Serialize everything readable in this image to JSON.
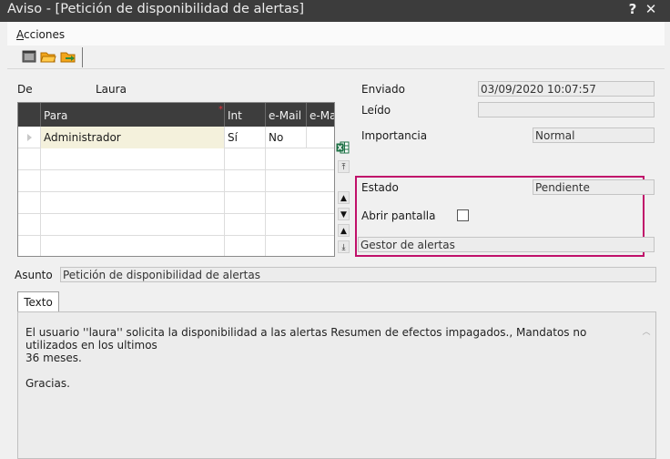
{
  "window": {
    "title": "Aviso - [Petición de disponibilidad de alertas]",
    "help_label": "?",
    "close_label": "✕"
  },
  "menu": {
    "items": [
      {
        "accel": "A",
        "rest": "cciones"
      }
    ]
  },
  "toolbar": {
    "tools": [
      "window-icon",
      "open-folder-icon",
      "folder-arrow-icon"
    ]
  },
  "from": {
    "label": "De",
    "value": "Laura"
  },
  "recipients": {
    "columns": [
      "Para",
      "Int",
      "e-Mail",
      "e-Ma"
    ],
    "rows": [
      {
        "para": "Administrador",
        "int": "Sí",
        "email": "No",
        "email2": ""
      }
    ]
  },
  "sent": {
    "label": "Enviado",
    "value": "03/09/2020 10:07:57"
  },
  "read": {
    "label": "Leído",
    "value": ""
  },
  "importance": {
    "label": "Importancia",
    "value": "Normal"
  },
  "status": {
    "label": "Estado",
    "value": "Pendiente"
  },
  "open_screen": {
    "label": "Abrir pantalla",
    "checked": false
  },
  "alert_manager": {
    "value": "Gestor de alertas"
  },
  "subject": {
    "label": "Asunto",
    "value": "Petición de disponibilidad de alertas"
  },
  "tabs": [
    {
      "label": "Texto"
    }
  ],
  "body": {
    "line1": "El usuario ''laura'' solicita la disponibilidad a las alertas Resumen de efectos impagados., Mandatos no utilizados en los ultimos",
    "line2": "36 meses.",
    "line3": "",
    "line4": "Gracias."
  },
  "colors": {
    "highlight": "#c0106a",
    "titlebar": "#3c3c3c",
    "grid_header": "#3d3d3d"
  }
}
